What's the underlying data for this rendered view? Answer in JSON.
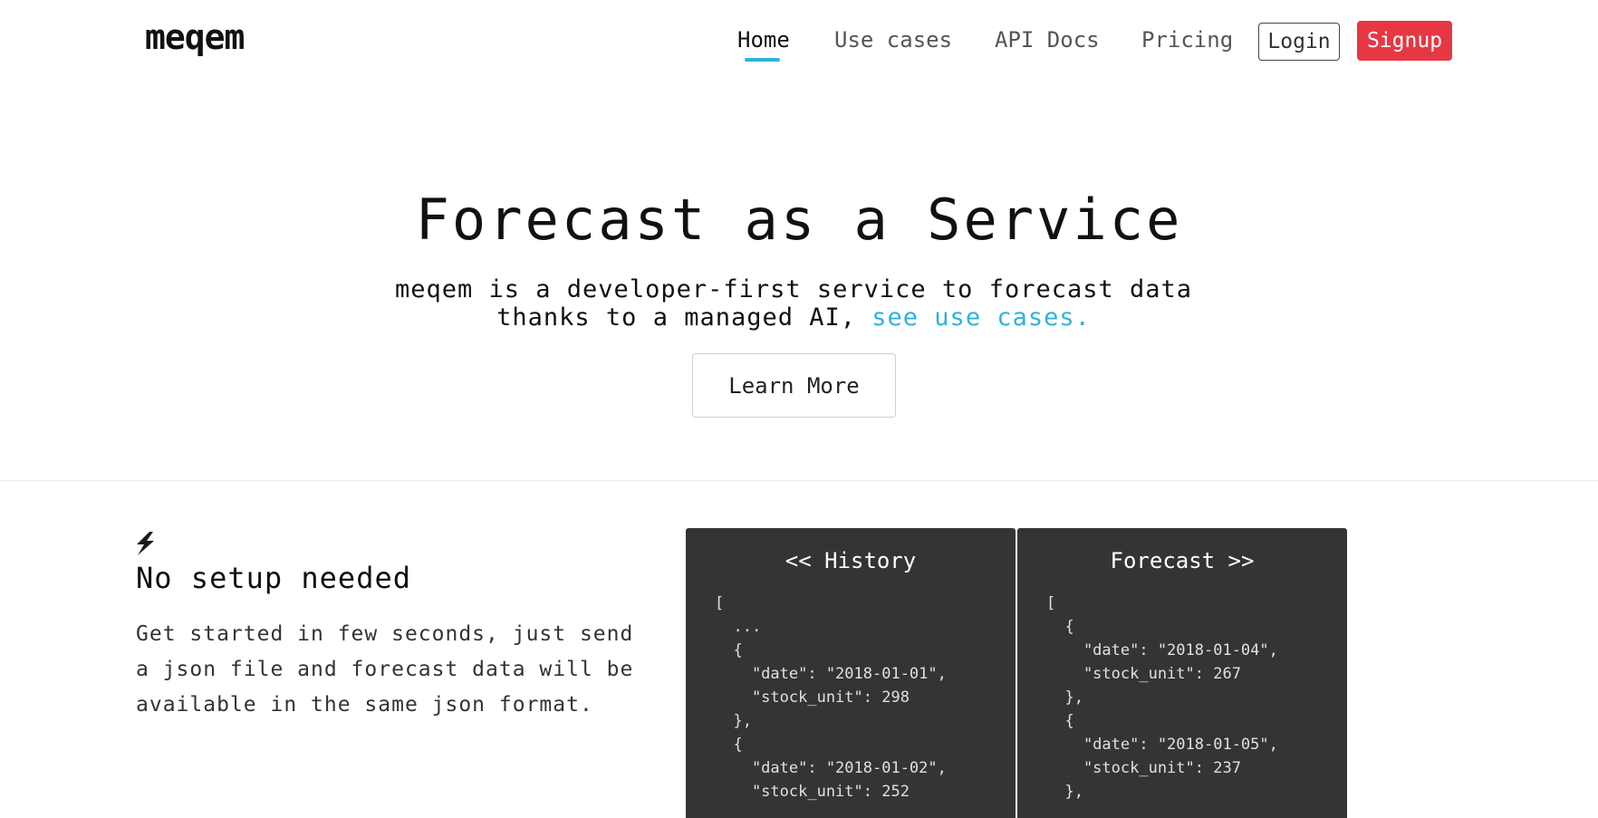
{
  "header": {
    "logo": "meqem",
    "nav": [
      {
        "label": "Home",
        "active": true
      },
      {
        "label": "Use cases",
        "active": false
      },
      {
        "label": "API Docs",
        "active": false
      },
      {
        "label": "Pricing",
        "active": false
      }
    ],
    "login_label": "Login",
    "signup_label": "Signup"
  },
  "hero": {
    "title": "Forecast as a Service",
    "subtitle_line1": "meqem is a developer-first service to forecast data",
    "subtitle_line2": "thanks to a managed AI,",
    "subtitle_link": "see use cases.",
    "learn_more_label": "Learn More"
  },
  "feature": {
    "icon": "lightning-bolt-icon",
    "title": "No setup needed",
    "text": "Get started in few seconds, just send a json file and forecast data will be available in the same json format."
  },
  "panels": {
    "history": {
      "title": "<< History",
      "code": "[\n  ...\n  {\n    \"date\": \"2018-01-01\",\n    \"stock_unit\": 298\n  },\n  {\n    \"date\": \"2018-01-02\",\n    \"stock_unit\": 252"
    },
    "forecast": {
      "title": "Forecast >>",
      "code": "[\n  {\n    \"date\": \"2018-01-04\",\n    \"stock_unit\": 267\n  },\n  {\n    \"date\": \"2018-01-05\",\n    \"stock_unit\": 237\n  },"
    }
  },
  "colors": {
    "accent": "#2fb3d9",
    "signup": "#e63744",
    "panel_bg": "#343434"
  }
}
